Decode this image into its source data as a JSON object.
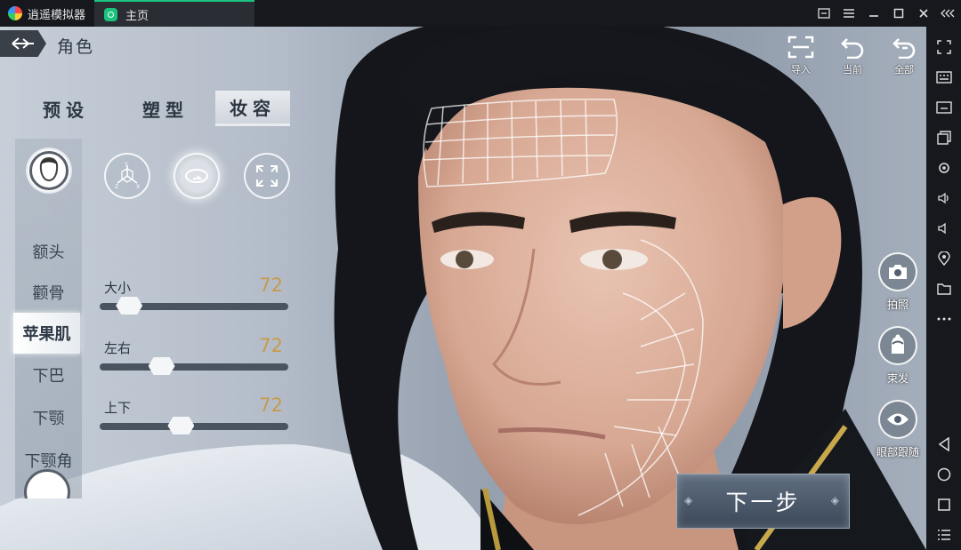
{
  "emulator": {
    "app_name": "逍遥模拟器",
    "home_tab": "主页"
  },
  "game": {
    "screen_title": "角色",
    "category_tabs": [
      "预设",
      "塑型",
      "妆容"
    ],
    "active_category": "妆容",
    "face_parts": [
      "额头",
      "颧骨",
      "苹果肌",
      "下巴",
      "下颚",
      "下颚角"
    ],
    "active_face_part": "苹果肌",
    "sliders": [
      {
        "label": "大小",
        "value": "72",
        "level": 0.1
      },
      {
        "label": "左右",
        "value": "72",
        "level": 0.3
      },
      {
        "label": "上下",
        "value": "72",
        "level": 0.42
      }
    ],
    "top_actions": [
      "导入",
      "当前",
      "全部"
    ],
    "right_actions": [
      "拍照",
      "束发",
      "眼部跟随"
    ],
    "next_button": "下一步",
    "colors": {
      "accent_value": "#c89a4b",
      "emulator_accent": "#19c37d"
    }
  }
}
